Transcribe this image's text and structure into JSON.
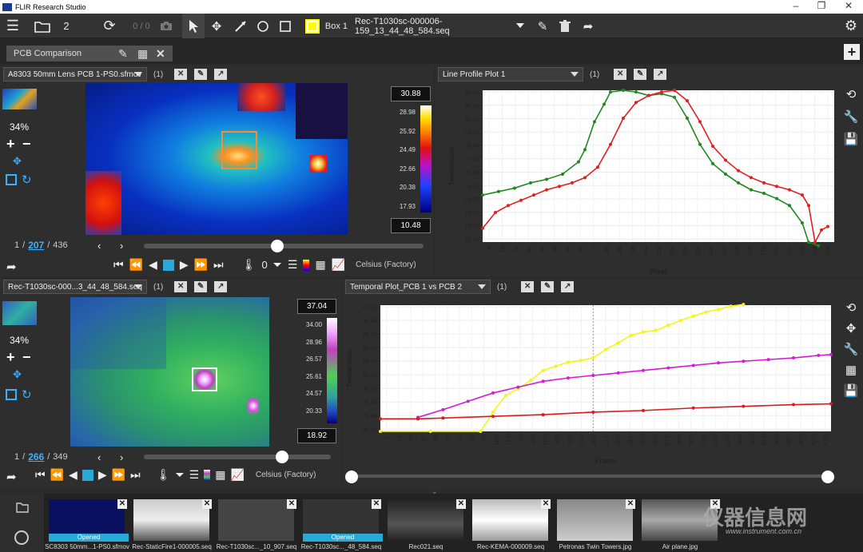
{
  "app": {
    "title": "FLIR Research Studio"
  },
  "toolbar": {
    "layout_count": "2",
    "frame_nav": "0 / 0",
    "roi_name": "Box 1",
    "file_name": "Rec-T1030sc-000006-159_13_44_48_584.seq"
  },
  "doc_tab": {
    "label": "PCB Comparison"
  },
  "top_left": {
    "file": "A8303 50mm Lens PCB 1-PS0.sfmov",
    "count": "(1)",
    "zoom": "34%",
    "scale_max": "30.88",
    "scale_min": "10.48",
    "scale_ticks": [
      "28.98",
      "25.92",
      "24.49",
      "22.66",
      "20.38",
      "17.93"
    ],
    "frame_current": "1",
    "frame_mark": "207",
    "frame_total": "436",
    "filter_count": "0",
    "units": "Celsius (Factory)",
    "slider_pos": 0.5
  },
  "bottom_left": {
    "file": "Rec-T1030sc-000...3_44_48_584.seq",
    "count": "(1)",
    "zoom": "34%",
    "scale_max": "37.04",
    "scale_min": "18.92",
    "scale_ticks": [
      "34.00",
      "28.96",
      "26.57",
      "25.61",
      "24.57",
      "20.33"
    ],
    "frame_current": "1",
    "frame_mark": "266",
    "frame_total": "349",
    "units": "Celsius (Factory)",
    "slider_pos": 0.76
  },
  "line_plot": {
    "selector": "Line Profile Plot 1",
    "count": "(1)",
    "ylabel": "Temperature",
    "xlabel": "Pixel",
    "yticks": [
      "31.60",
      "30.81",
      "30.02",
      "29.23",
      "28.44",
      "27.65",
      "26.86",
      "26.07",
      "25.28",
      "24.49",
      "23.70",
      "22.91"
    ],
    "xticks": [
      "8",
      "16",
      "24",
      "32",
      "40",
      "48",
      "56",
      "64",
      "72",
      "80",
      "88",
      "96",
      "104",
      "112",
      "120",
      "128",
      "136",
      "144",
      "152",
      "160",
      "168",
      "176",
      "184",
      "192",
      "200",
      "208",
      "216"
    ]
  },
  "temporal_plot": {
    "selector": "Temporal Plot_PCB 1 vs PCB 2",
    "count": "(1)",
    "ylabel": "Temperature",
    "xlabel": "Frame",
    "yticks": [
      "40.32",
      "38.64",
      "36.96",
      "35.28",
      "33.60",
      "31.92",
      "30.24",
      "28.56",
      "26.88",
      "25.20"
    ],
    "xticks": [
      "1",
      "13",
      "25",
      "37",
      "49",
      "61",
      "73",
      "85",
      "97",
      "109",
      "121",
      "133",
      "145",
      "157",
      "169",
      "181",
      "193",
      "205",
      "217",
      "229",
      "241",
      "253",
      "265",
      "277",
      "289",
      "301",
      "313",
      "325",
      "337",
      "349",
      "361",
      "373",
      "385",
      "397",
      "409",
      "421",
      "433"
    ]
  },
  "chart_data": [
    {
      "type": "line",
      "xlabel": "Pixel",
      "ylabel": "Temperature",
      "ylim": [
        22.91,
        31.6
      ],
      "xlim": [
        0,
        220
      ],
      "series": [
        {
          "color": "#1e8a1e",
          "x": [
            0,
            10,
            20,
            30,
            40,
            50,
            60,
            64,
            70,
            76,
            80,
            88,
            96,
            104,
            112,
            120,
            128,
            136,
            144,
            152,
            160,
            168,
            176,
            184,
            192,
            200,
            204,
            210
          ],
          "y": [
            25.6,
            25.8,
            26.0,
            26.3,
            26.5,
            26.8,
            27.5,
            28.2,
            29.8,
            30.8,
            31.5,
            31.6,
            31.5,
            31.3,
            31.4,
            31.2,
            30.0,
            28.5,
            27.4,
            26.8,
            26.3,
            25.9,
            25.7,
            25.4,
            25.0,
            24.0,
            22.9,
            22.7
          ]
        },
        {
          "color": "#e02020",
          "x": [
            0,
            8,
            16,
            24,
            32,
            40,
            48,
            56,
            64,
            72,
            80,
            88,
            96,
            104,
            112,
            120,
            128,
            136,
            144,
            152,
            160,
            168,
            176,
            184,
            192,
            200,
            204,
            208,
            212,
            216
          ],
          "y": [
            23.7,
            24.6,
            25.0,
            25.3,
            25.6,
            25.9,
            26.1,
            26.3,
            26.6,
            27.2,
            28.5,
            30.0,
            30.9,
            31.3,
            31.5,
            31.6,
            31.0,
            29.8,
            28.4,
            27.6,
            27.0,
            26.6,
            26.3,
            26.1,
            25.9,
            25.6,
            25.0,
            22.9,
            23.6,
            23.8
          ]
        }
      ]
    },
    {
      "type": "line",
      "xlabel": "Frame",
      "ylabel": "Temperature",
      "ylim": [
        25.2,
        40.32
      ],
      "xlim": [
        1,
        433
      ],
      "series": [
        {
          "color": "#f5f51a",
          "x": [
            1,
            49,
            97,
            109,
            121,
            133,
            145,
            157,
            169,
            181,
            193,
            205,
            217,
            229,
            241,
            253,
            265,
            277,
            289,
            301,
            313,
            325,
            337,
            349
          ],
          "y": [
            25.2,
            25.2,
            25.2,
            27.5,
            29.5,
            30.3,
            31.3,
            32.5,
            33.0,
            33.5,
            33.7,
            34.0,
            35.0,
            35.8,
            36.7,
            37.1,
            37.3,
            37.9,
            38.5,
            39.0,
            39.5,
            39.8,
            40.2,
            40.4
          ]
        },
        {
          "color": "#d81bd8",
          "x": [
            37,
            61,
            85,
            109,
            133,
            157,
            181,
            205,
            229,
            253,
            277,
            301,
            325,
            349,
            373,
            397,
            421,
            433
          ],
          "y": [
            26.88,
            27.8,
            28.8,
            29.8,
            30.5,
            31.2,
            31.6,
            31.9,
            32.2,
            32.5,
            32.8,
            33.1,
            33.4,
            33.6,
            33.8,
            34.0,
            34.3,
            34.4
          ]
        },
        {
          "color": "#d81b1b",
          "x": [
            1,
            37,
            61,
            109,
            157,
            205,
            253,
            301,
            349,
            397,
            433
          ],
          "y": [
            26.7,
            26.7,
            26.8,
            27.0,
            27.2,
            27.5,
            27.7,
            28.0,
            28.2,
            28.4,
            28.5
          ]
        }
      ]
    }
  ],
  "thumbnails": [
    {
      "label": "SC8303 50mm...1-PS0.sfmov",
      "status": "Opened"
    },
    {
      "label": "Rec-StaticFire1-000005.seq",
      "status": ""
    },
    {
      "label": "Rec-T1030sc..._10_907.seq",
      "status": ""
    },
    {
      "label": "Rec-T1030sc..._48_584.seq",
      "status": "Opened"
    },
    {
      "label": "Rec021.seq",
      "status": ""
    },
    {
      "label": "Rec-KEMA-000009.seq",
      "status": ""
    },
    {
      "label": "Petronas Twin Towers.jpg",
      "status": ""
    },
    {
      "label": "Air plane.jpg",
      "status": ""
    }
  ],
  "watermark": {
    "cn": "仪器信息网",
    "url": "www.instrument.com.cn"
  }
}
